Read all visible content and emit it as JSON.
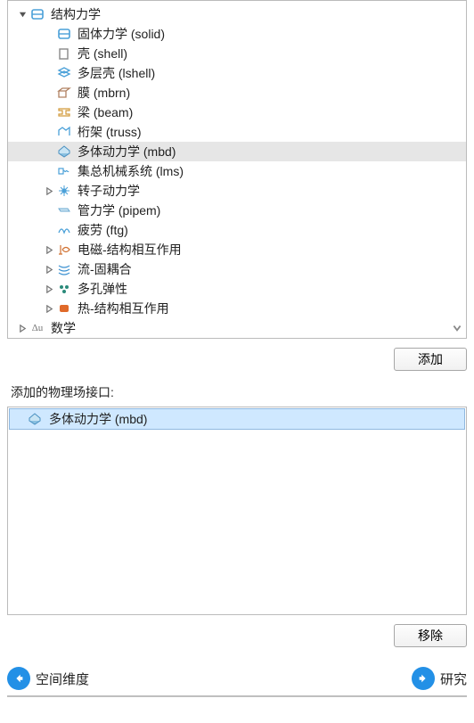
{
  "tree": {
    "root": {
      "label": "结构力学"
    },
    "items": [
      {
        "label": "固体力学 (solid)"
      },
      {
        "label": "壳 (shell)"
      },
      {
        "label": "多层壳 (lshell)"
      },
      {
        "label": "膜 (mbrn)"
      },
      {
        "label": "梁 (beam)"
      },
      {
        "label": "桁架 (truss)"
      },
      {
        "label": "多体动力学 (mbd)"
      },
      {
        "label": "集总机械系统 (lms)"
      },
      {
        "label": "转子动力学"
      },
      {
        "label": "管力学 (pipem)"
      },
      {
        "label": "疲劳 (ftg)"
      },
      {
        "label": "电磁-结构相互作用"
      },
      {
        "label": "流-固耦合"
      },
      {
        "label": "多孔弹性"
      },
      {
        "label": "热-结构相互作用"
      }
    ],
    "sibling": {
      "label": "数学"
    }
  },
  "buttons": {
    "add": "添加",
    "remove": "移除"
  },
  "section": {
    "added_label": "添加的物理场接口:"
  },
  "added": {
    "item": "多体动力学 (mbd)"
  },
  "nav": {
    "back": "空间维度",
    "forward": "研究"
  }
}
